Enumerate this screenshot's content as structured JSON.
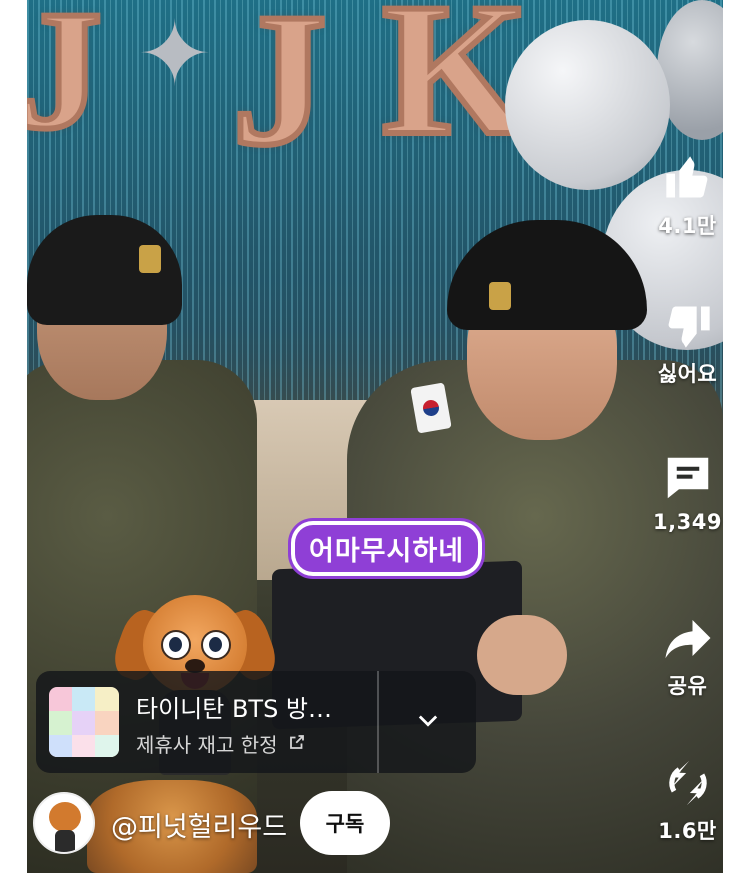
{
  "video": {
    "caption": "어마무시하네"
  },
  "actions": {
    "like_count": "4.1만",
    "dislike_label": "싫어요",
    "comment_count": "1,349",
    "share_label": "공유",
    "remix_count": "1.6만"
  },
  "product": {
    "title": "타이니탄 BTS 방…",
    "subtitle": "제휴사 재고 한정",
    "icons": {
      "external": "external-link-icon",
      "expand": "chevron-down-icon"
    }
  },
  "channel": {
    "handle": "@피넛헐리우드",
    "subscribe_label": "구독"
  },
  "colors": {
    "caption_bg": "#8f3fd6",
    "overlay_text": "#ffffff",
    "subscribe_bg": "#ffffff"
  }
}
